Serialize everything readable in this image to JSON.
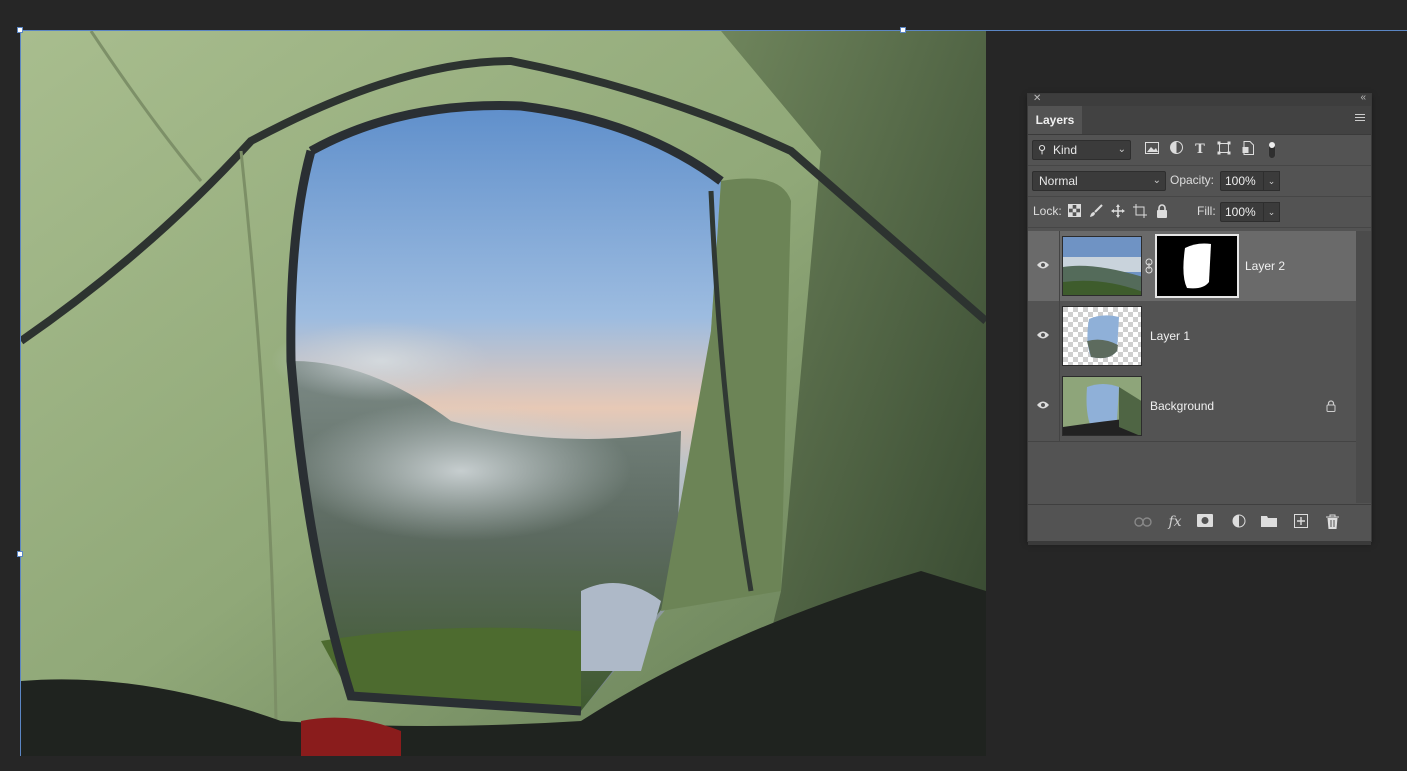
{
  "layers_panel": {
    "tab_label": "Layers",
    "filter": {
      "kind_label": "Kind"
    },
    "blend_mode": "Normal",
    "opacity_label": "Opacity:",
    "opacity_value": "100%",
    "lock_label": "Lock:",
    "fill_label": "Fill:",
    "fill_value": "100%",
    "layers": [
      {
        "name": "Layer 2",
        "visible": true,
        "selected": true,
        "has_mask": true
      },
      {
        "name": "Layer 1",
        "visible": true,
        "selected": false,
        "has_mask": false
      },
      {
        "name": "Background",
        "visible": true,
        "selected": false,
        "locked": true
      }
    ],
    "filter_icons": [
      "image-filter-icon",
      "adjustment-filter-icon",
      "type-filter-icon",
      "shape-filter-icon",
      "smart-object-filter-icon",
      "filter-toggle-icon"
    ],
    "lock_icons": [
      "lock-transparent-icon",
      "lock-paint-icon",
      "lock-position-icon",
      "lock-artboard-icon",
      "lock-all-icon"
    ],
    "bottom_icons": [
      "link-layers-icon",
      "fx-icon",
      "add-mask-icon",
      "adjustment-layer-icon",
      "new-group-icon",
      "new-layer-icon",
      "delete-layer-icon"
    ]
  },
  "canvas": {
    "image": "tent-view-photo"
  }
}
